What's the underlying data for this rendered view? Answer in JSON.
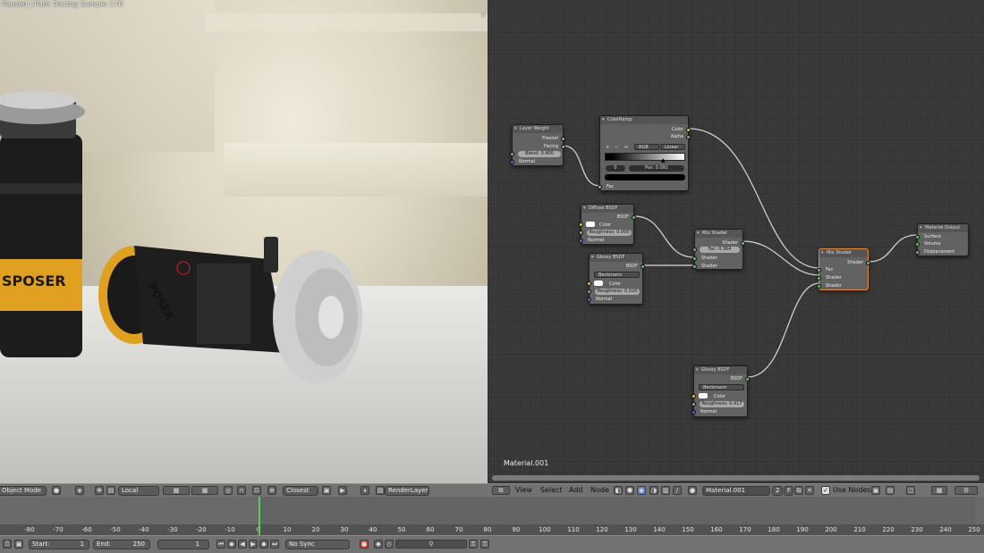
{
  "viewport": {
    "status": "Paused | Path Tracing Sample 176",
    "product_label_left": "SPOSER",
    "product_label_right": "POSER"
  },
  "viewport_header": {
    "mode": "Object Mode",
    "pivot": "Local",
    "snap": "Closest",
    "render_layer": "RenderLayer"
  },
  "node_editor": {
    "material_label": "Material.001",
    "nodes": {
      "layer_weight": {
        "title": "Layer Weight",
        "outputs": [
          "Fresnel",
          "Facing"
        ],
        "blend_label": "Blend:",
        "blend_value": "0.400",
        "input": "Normal"
      },
      "color_ramp": {
        "title": "ColorRamp",
        "outputs": [
          "Color",
          "Alpha"
        ],
        "plus": "+",
        "minus": "−",
        "arrows": "↔",
        "mode": "RGB",
        "interp": "Linear",
        "index": "0",
        "pos_label": "Pos:",
        "pos_value": "0.091",
        "input": "Fac"
      },
      "diffuse": {
        "title": "Diffuse BSDF",
        "output": "BSDF",
        "color": "Color",
        "roughness": "Roughness: 0.000",
        "normal": "Normal"
      },
      "glossy1": {
        "title": "Glossy BSDF",
        "output": "BSDF",
        "distribution": "Beckmann",
        "color": "Color",
        "roughness": "Roughness: 0.020",
        "normal": "Normal"
      },
      "mix1": {
        "title": "Mix Shader",
        "output": "Shader",
        "fac_label": "Fac:",
        "fac_value": "0.364",
        "shader1": "Shader",
        "shader2": "Shader"
      },
      "mix2": {
        "title": "Mix Shader",
        "output": "Shader",
        "fac": "Fac",
        "shader1": "Shader",
        "shader2": "Shader"
      },
      "output": {
        "title": "Material Output",
        "surface": "Surface",
        "volume": "Volume",
        "displacement": "Displacement"
      },
      "glossy2": {
        "title": "Glossy BSDF",
        "output": "BSDF",
        "distribution": "Beckmann",
        "color": "Color",
        "roughness": "Roughness: 0.417",
        "normal": "Normal"
      }
    }
  },
  "node_header": {
    "menus": [
      "View",
      "Select",
      "Add",
      "Node"
    ],
    "material_name": "Material.001",
    "users": "2",
    "fake_user": "F",
    "use_nodes_label": "Use Nodes"
  },
  "timeline": {
    "ticks": [
      "-80",
      "-70",
      "-60",
      "-50",
      "-40",
      "-30",
      "-20",
      "-10",
      "0",
      "10",
      "20",
      "30",
      "40",
      "50",
      "60",
      "70",
      "80",
      "90",
      "100",
      "110",
      "120",
      "130",
      "140",
      "150",
      "160",
      "170",
      "180",
      "190",
      "200",
      "210",
      "220",
      "230",
      "240",
      "250"
    ],
    "current_frame": 0
  },
  "bottom_bar": {
    "start_label": "Start:",
    "start_value": "1",
    "end_label": "End:",
    "end_value": "250",
    "frame_value": "1",
    "sync": "No Sync"
  },
  "colors": {
    "accent_active": "#e28c3a",
    "socket_shader": "#64c864",
    "socket_color": "#e0c74a",
    "socket_float": "#a0a0a0",
    "socket_vector": "#6363c7",
    "playhead": "#58d158"
  }
}
